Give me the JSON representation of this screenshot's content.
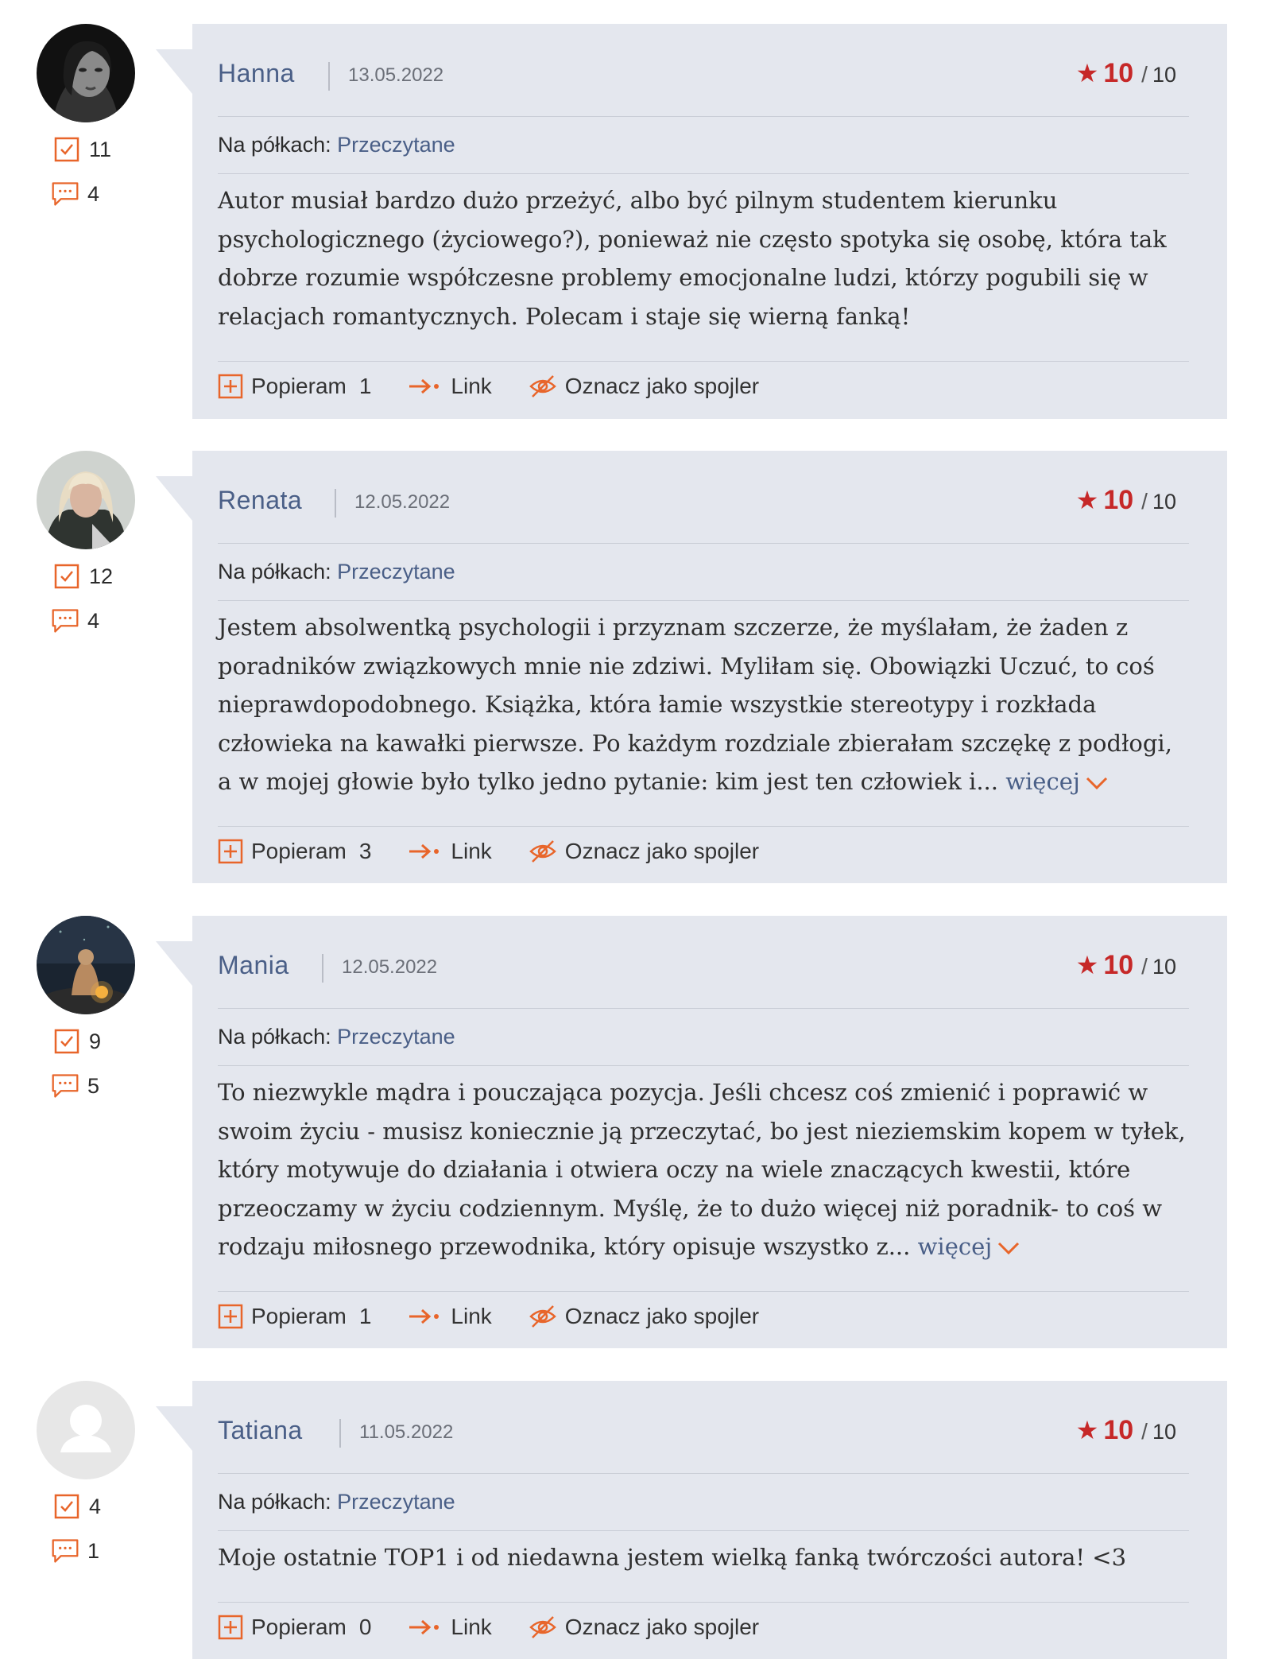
{
  "reviews": [
    {
      "user": "Hanna",
      "date": "13.05.2022",
      "rating": "10",
      "rating_max": "10",
      "shelves_label": "Na półkach:",
      "shelf": "Przeczytane",
      "text": "Autor musiał bardzo dużo przeżyć, albo być pilnym studentem kierunku psychologicznego (życiowego?), ponieważ nie często spotyka się osobę, która tak dobrze rozumie współczesne problemy emocjonalne ludzi, którzy pogubili się w relacjach romantycznych. Polecam i staje się wierną fanką!",
      "more": "",
      "read_count": "11",
      "comment_count": "4",
      "support_label": "Popieram",
      "support_count": "1",
      "link_label": "Link",
      "spoiler_label": "Oznacz jako spojler"
    },
    {
      "user": "Renata",
      "date": "12.05.2022",
      "rating": "10",
      "rating_max": "10",
      "shelves_label": "Na półkach:",
      "shelf": "Przeczytane",
      "text": "Jestem absolwentką psychologii i przyznam szczerze, że myślałam, że żaden z poradników związkowych mnie nie zdziwi. Myliłam się. Obowiązki Uczuć, to coś nieprawdopodobnego. Książka, która łamie wszystkie stereotypy i rozkłada człowieka na kawałki pierwsze. Po każdym rozdziale zbierałam szczękę z podłogi, a w mojej głowie było tylko jedno pytanie: kim jest ten człowiek i...",
      "more": "więcej",
      "read_count": "12",
      "comment_count": "4",
      "support_label": "Popieram",
      "support_count": "3",
      "link_label": "Link",
      "spoiler_label": "Oznacz jako spojler"
    },
    {
      "user": "Mania",
      "date": "12.05.2022",
      "rating": "10",
      "rating_max": "10",
      "shelves_label": "Na półkach:",
      "shelf": "Przeczytane",
      "text": "To niezwykle mądra i pouczająca pozycja. Jeśli chcesz coś zmienić i poprawić w swoim życiu - musisz koniecznie ją przeczytać, bo jest nieziemskim kopem w tyłek, który motywuje do działania i otwiera oczy na wiele znaczących kwestii, które przeoczamy w życiu codziennym. Myślę, że to dużo więcej niż poradnik- to coś w rodzaju miłosnego przewodnika, który opisuje wszystko z...",
      "more": "więcej",
      "read_count": "9",
      "comment_count": "5",
      "support_label": "Popieram",
      "support_count": "1",
      "link_label": "Link",
      "spoiler_label": "Oznacz jako spojler"
    },
    {
      "user": "Tatiana",
      "date": "11.05.2022",
      "rating": "10",
      "rating_max": "10",
      "shelves_label": "Na półkach:",
      "shelf": "Przeczytane",
      "text": "Moje ostatnie TOP1 i od niedawna jestem wielką fanką twórczości autora! <3",
      "more": "",
      "read_count": "4",
      "comment_count": "1",
      "support_label": "Popieram",
      "support_count": "0",
      "link_label": "Link",
      "spoiler_label": "Oznacz jako spojler"
    }
  ],
  "colors": {
    "accent": "#e8652a",
    "rating": "#c62828",
    "link": "#4a5f87",
    "card": "#e4e7ee"
  }
}
